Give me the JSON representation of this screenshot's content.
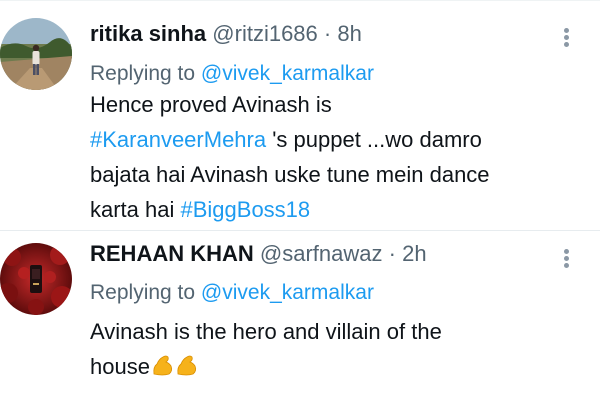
{
  "tweets": [
    {
      "name": "ritika sinha",
      "handle": "@ritzi1686",
      "separator": "·",
      "time": "8h",
      "replying_prefix": "Replying to ",
      "replying_to": "@vivek_karmalkar",
      "text": {
        "part1": "Hence proved Avinash is",
        "hashtag1": "#KaranveerMehra",
        "part2": " 's puppet ...wo damro",
        "part3": "bajata hai Avinash uske tune mein dance",
        "part4": "karta hai ",
        "hashtag2": "#BiggBoss18"
      }
    },
    {
      "name": "REHAAN KHAN",
      "handle": "@sarfnawaz",
      "separator": "·",
      "time": "2h",
      "replying_prefix": "Replying to ",
      "replying_to": "@vivek_karmalkar",
      "text": {
        "part1": "Avinash is the hero and villain of the",
        "part2": "house",
        "emojis": "💪💪"
      }
    }
  ],
  "colors": {
    "link": "#1d9bf0",
    "secondary_text": "#536471",
    "primary_text": "#0f1419"
  },
  "icons": [
    "more-options-icon",
    "flexed-biceps-emoji"
  ]
}
